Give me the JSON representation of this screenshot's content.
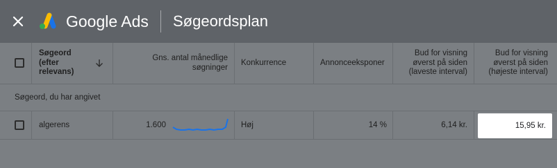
{
  "header": {
    "product_name": "Google Ads",
    "tool_name": "Søgeordsplan"
  },
  "table": {
    "columns": [
      "Søgeord (efter relevans)",
      "Gns. antal månedlige søgninger",
      "Konkurrence",
      "Annonceeksponer",
      "Bud for visning øverst på siden (laveste interval)",
      "Bud for visning øverst på siden (højeste interval)"
    ],
    "section_label": "Søgeord, du har angivet",
    "rows": [
      {
        "keyword": "algerens",
        "avg_monthly_searches": "1.600",
        "competition": "Høj",
        "impression_share": "14 %",
        "bid_low": "6,14 kr.",
        "bid_high": "15,95 kr."
      }
    ]
  },
  "sort_direction": "descending",
  "colors": {
    "header_bg": "#5f6368",
    "trend_line": "#1a73e8"
  }
}
